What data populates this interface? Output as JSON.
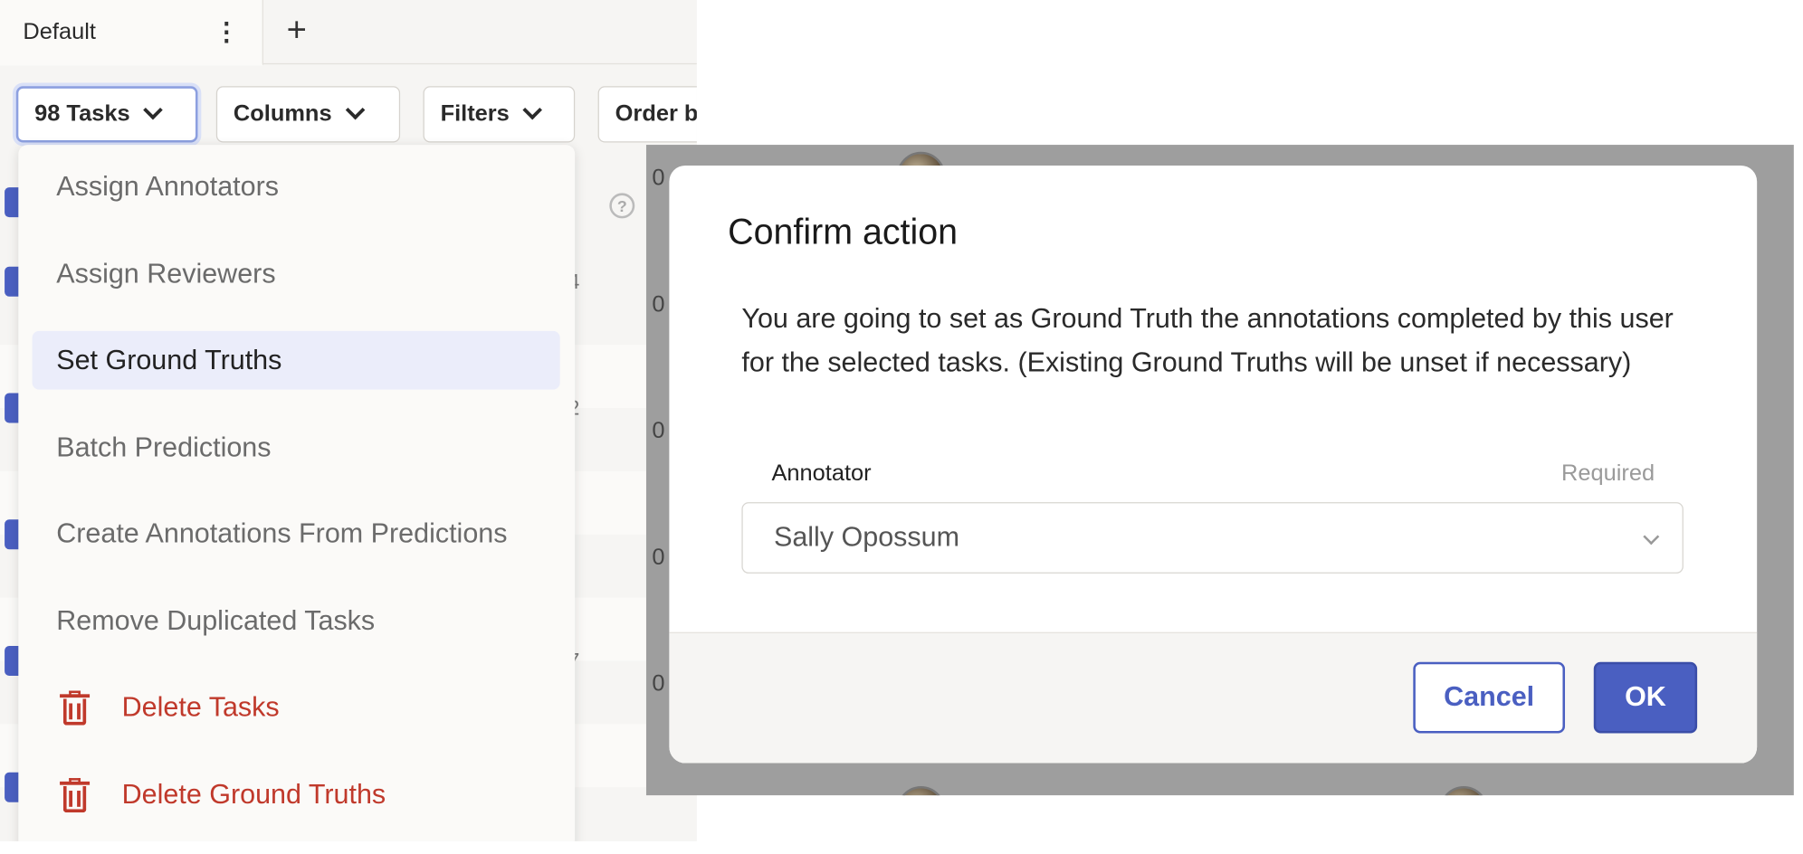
{
  "tab": {
    "label": "Default",
    "menu_icon": "kebab-icon",
    "add_icon": "plus-icon"
  },
  "toolbar": {
    "tasks_label": "98 Tasks",
    "columns_label": "Columns",
    "filters_label": "Filters",
    "order_label": "Order b"
  },
  "table": {
    "peek_values": [
      "4",
      "2",
      "7"
    ],
    "backdrop_values": [
      "0",
      "0",
      "0",
      "0",
      "0"
    ]
  },
  "menu": {
    "items": [
      {
        "label": "Assign Annotators"
      },
      {
        "label": "Assign Reviewers"
      },
      {
        "label": "Set Ground Truths"
      },
      {
        "label": "Batch Predictions"
      },
      {
        "label": "Create Annotations From Predictions"
      },
      {
        "label": "Remove Duplicated Tasks"
      },
      {
        "label": "Delete Tasks"
      },
      {
        "label": "Delete Ground Truths"
      }
    ],
    "active_index": 2
  },
  "modal": {
    "title": "Confirm action",
    "body": "You are going to set as Ground Truth the annotations completed by this user for the selected tasks. (Existing Ground Truths will be unset if necessary)",
    "field_label": "Annotator",
    "field_required": "Required",
    "select_value": "Sally Opossum",
    "cancel_label": "Cancel",
    "ok_label": "OK"
  },
  "colors": {
    "accent": "#4a5fc1",
    "danger": "#c0392b",
    "active_item_bg": "#ebedfa",
    "backdrop": "#9e9e9e"
  }
}
